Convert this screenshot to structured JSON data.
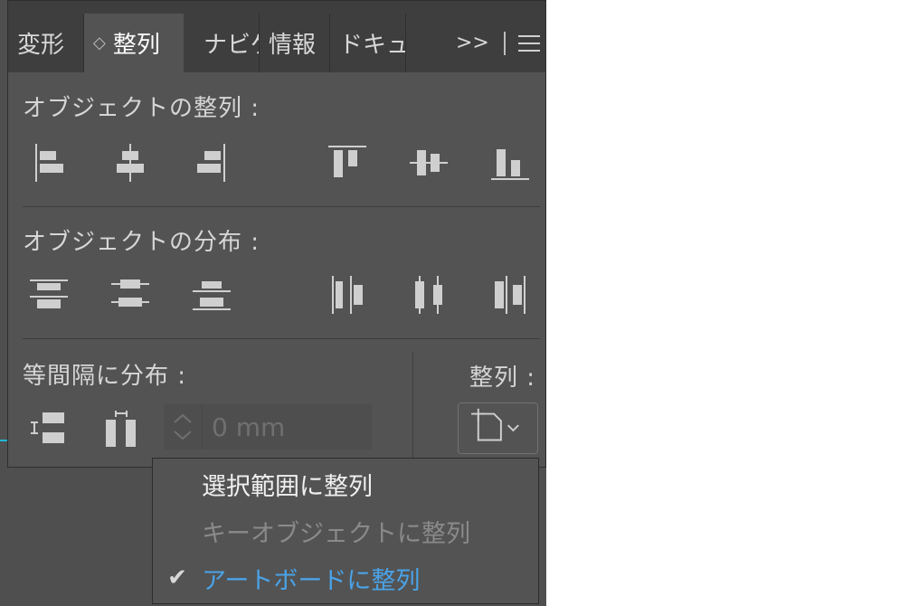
{
  "tabs": [
    {
      "label": "変形"
    },
    {
      "label": "整列",
      "active": true,
      "prefix_icon": "updown-arrows-icon"
    },
    {
      "label": "ナビゲ"
    },
    {
      "label": "情報"
    },
    {
      "label": "ドキュ"
    }
  ],
  "tab_overflow": {
    "label": ">>"
  },
  "sections": {
    "align_objects": {
      "title": "オブジェクトの整列 :",
      "buttons": [
        "align-left-icon",
        "align-horizontal-center-icon",
        "align-right-icon",
        "align-top-icon",
        "align-vertical-center-icon",
        "align-bottom-icon"
      ]
    },
    "distribute_objects": {
      "title": "オブジェクトの分布 :",
      "buttons": [
        "distribute-top-icon",
        "distribute-vertical-center-icon",
        "distribute-bottom-icon",
        "distribute-left-icon",
        "distribute-horizontal-center-icon",
        "distribute-right-icon"
      ]
    },
    "distribute_spacing": {
      "title": "等間隔に分布 :",
      "buttons": [
        "vertical-distribute-space-icon",
        "horizontal-distribute-space-icon"
      ],
      "spacing_value": "0 mm"
    },
    "align_to": {
      "title": "整列 :",
      "current": "artboard-icon"
    }
  },
  "dropdown": {
    "items": [
      {
        "label": "選択範囲に整列",
        "checked": false,
        "state": "normal"
      },
      {
        "label": "キーオブジェクトに整列",
        "checked": false,
        "state": "disabled"
      },
      {
        "label": "アートボードに整列",
        "checked": true,
        "state": "selected"
      }
    ]
  },
  "colors": {
    "panel_bg": "#535353",
    "tabbar_bg": "#3e3e3e",
    "text": "#d6d6d6",
    "selected_text": "#4aa3e8",
    "disabled_text": "#8a8a8a",
    "accent_cyan": "#1fb6d6"
  }
}
